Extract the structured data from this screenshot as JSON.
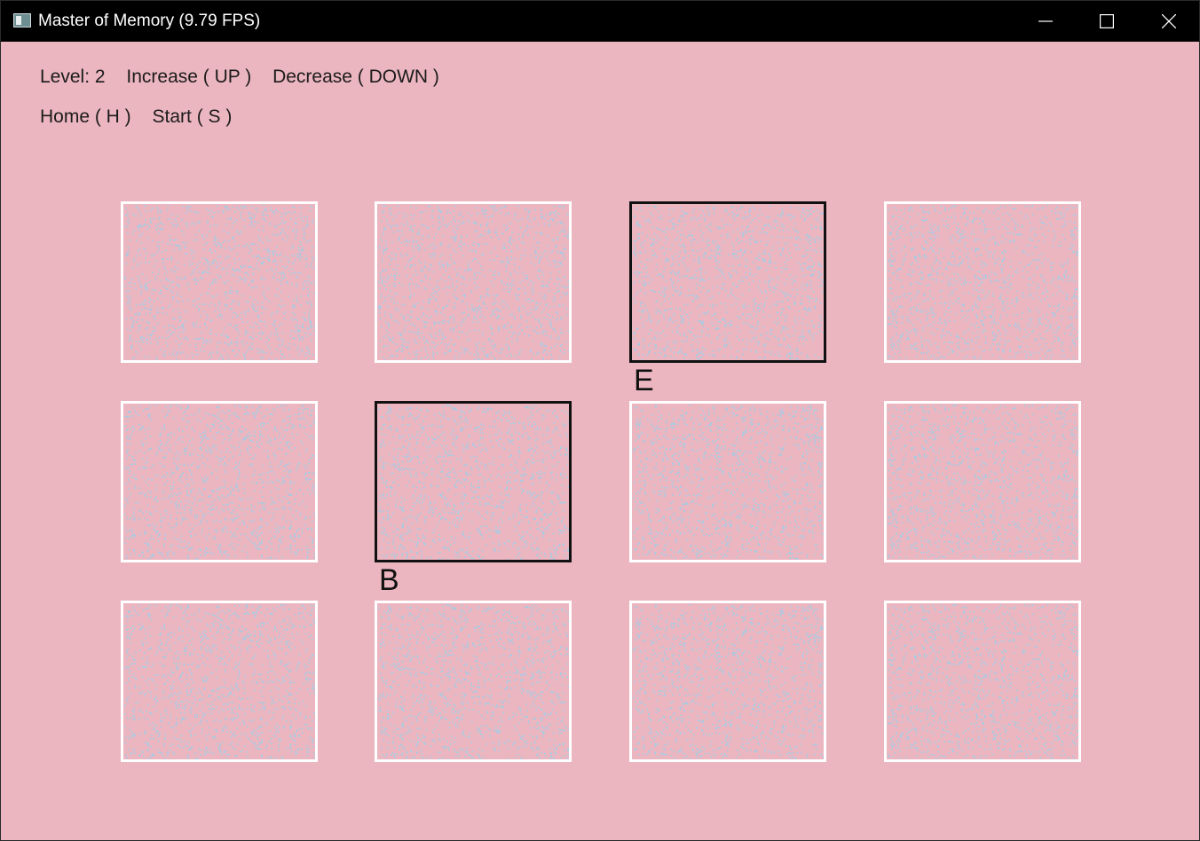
{
  "window": {
    "title": "Master of Memory (9.79 FPS)",
    "icon": "app-icon",
    "controls": [
      "minimize-icon",
      "maximize-icon",
      "close-icon"
    ]
  },
  "hud": {
    "level_text": "Level: 2",
    "increase_text": "Increase ( UP )",
    "decrease_text": "Decrease ( DOWN )",
    "home_text": "Home ( H )",
    "start_text": "Start ( S )"
  },
  "colors": {
    "background": "#ecb6c0",
    "card_border": "#ffffff",
    "selected_border": "#111111",
    "dots": "#9fcde6",
    "titlebar": "#000000"
  },
  "grid": {
    "rows": 3,
    "cols": 4,
    "cards": [
      {
        "row": 0,
        "col": 0,
        "selected": false,
        "label": ""
      },
      {
        "row": 0,
        "col": 1,
        "selected": false,
        "label": ""
      },
      {
        "row": 0,
        "col": 2,
        "selected": true,
        "label": "E"
      },
      {
        "row": 0,
        "col": 3,
        "selected": false,
        "label": ""
      },
      {
        "row": 1,
        "col": 0,
        "selected": false,
        "label": ""
      },
      {
        "row": 1,
        "col": 1,
        "selected": true,
        "label": "B"
      },
      {
        "row": 1,
        "col": 2,
        "selected": false,
        "label": ""
      },
      {
        "row": 1,
        "col": 3,
        "selected": false,
        "label": ""
      },
      {
        "row": 2,
        "col": 0,
        "selected": false,
        "label": ""
      },
      {
        "row": 2,
        "col": 1,
        "selected": false,
        "label": ""
      },
      {
        "row": 2,
        "col": 2,
        "selected": false,
        "label": ""
      },
      {
        "row": 2,
        "col": 3,
        "selected": false,
        "label": ""
      }
    ]
  }
}
